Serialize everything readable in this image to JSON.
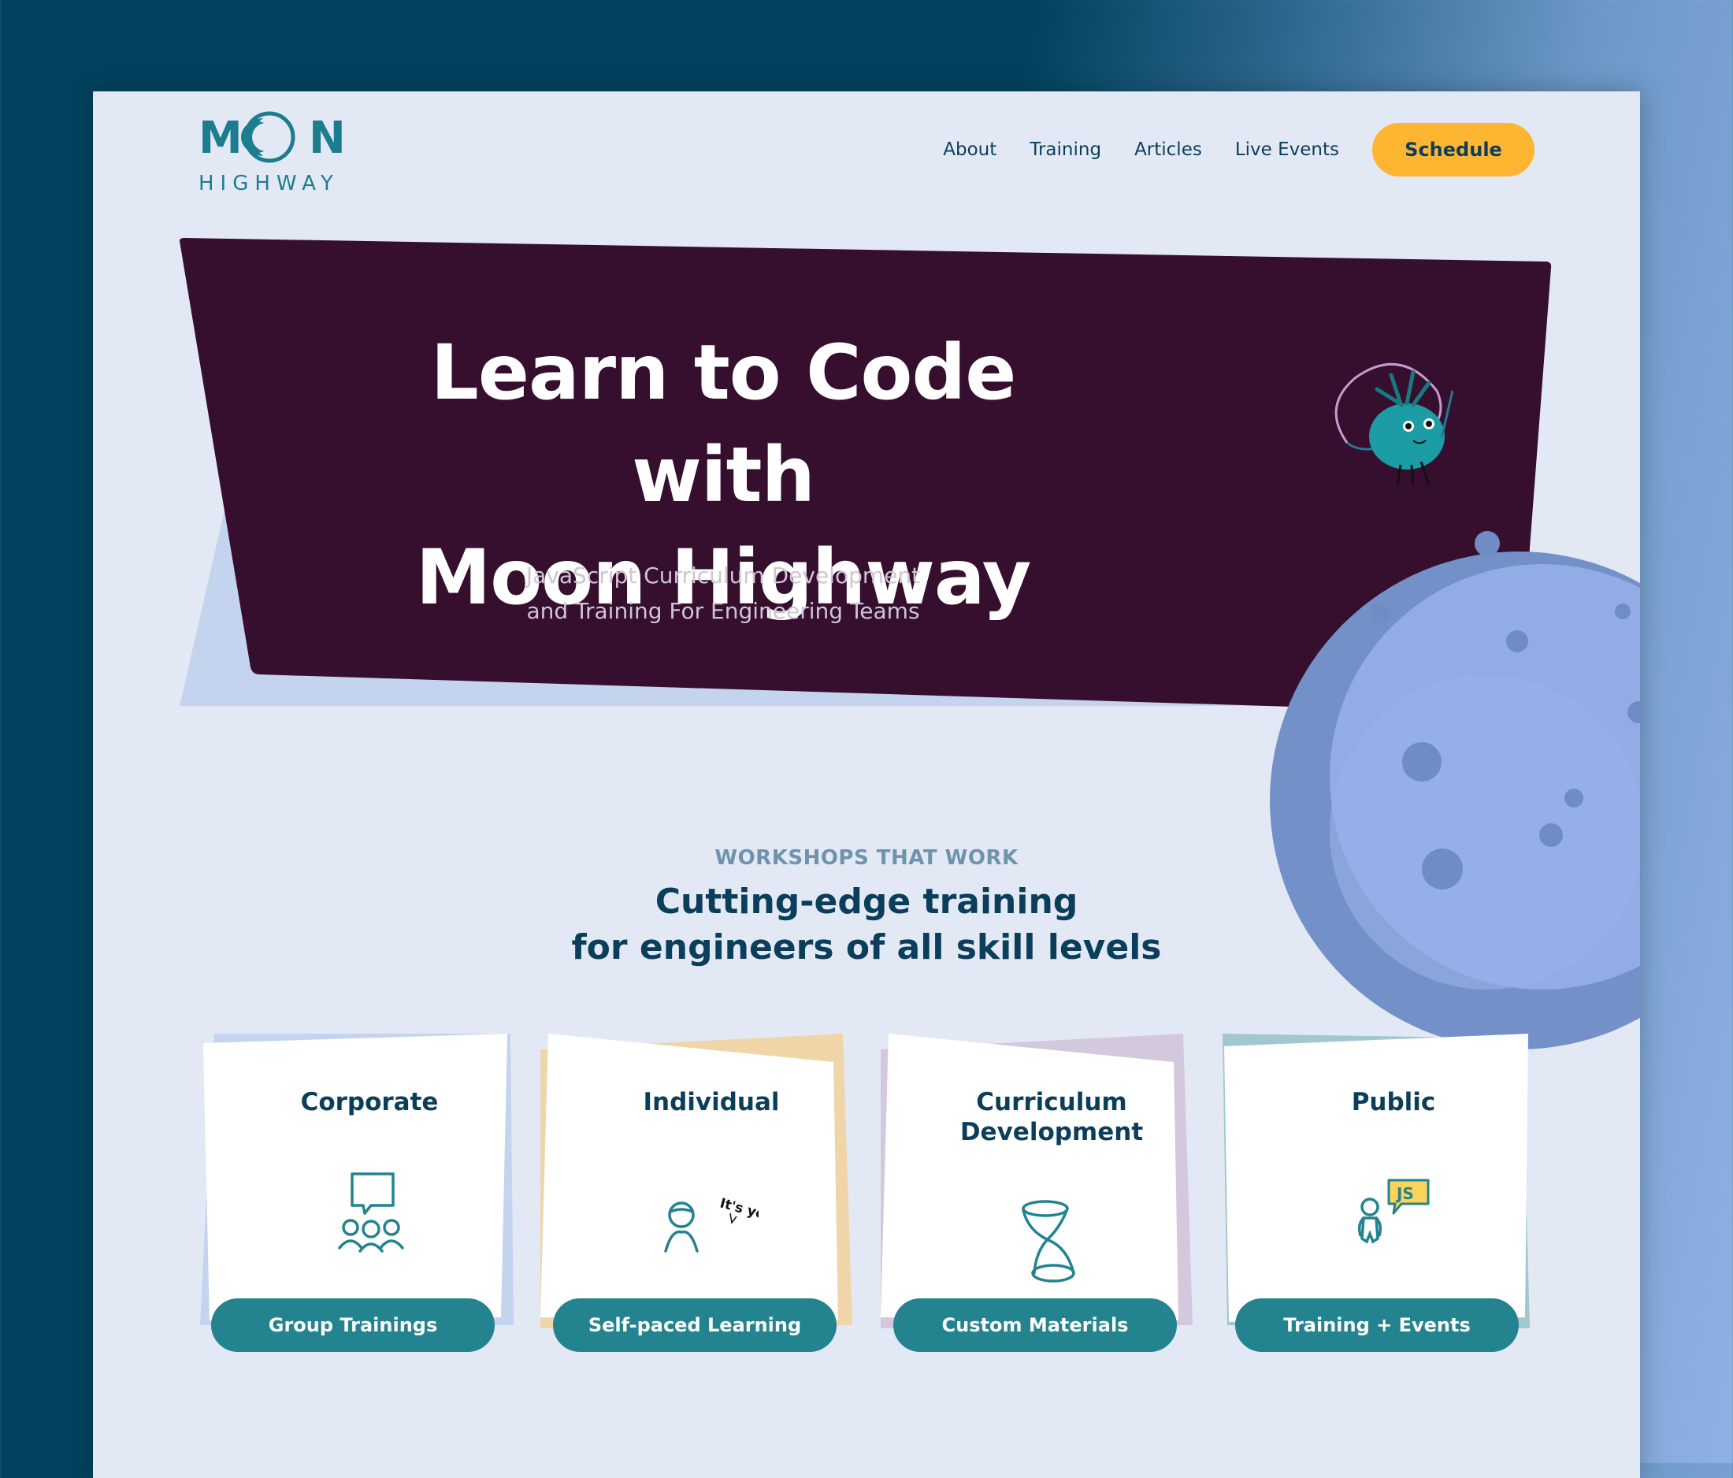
{
  "logo": {
    "top": "MOON",
    "word": "HIGHWAY"
  },
  "nav": {
    "items": [
      "About",
      "Training",
      "Articles",
      "Live Events"
    ],
    "cta": "Schedule"
  },
  "hero": {
    "title_line1": "Learn to Code with",
    "title_line2": "Moon Highway",
    "subtitle_line1": "JavaScript Curriculum Development",
    "subtitle_line2": "and Training For Engineering Teams"
  },
  "workshops": {
    "eyebrow": "WORKSHOPS THAT WORK",
    "title_line1": "Cutting-edge training",
    "title_line2": "for engineers of all skill levels"
  },
  "cards": [
    {
      "title": "Corporate",
      "button": "Group Trainings",
      "icon": "group-chat-icon",
      "accent": "#c4d4ee"
    },
    {
      "title": "Individual",
      "button": "Self-paced Learning",
      "icon": "person-its-you-icon",
      "icon_text": "It's you",
      "accent": "#efd5a8"
    },
    {
      "title_line1": "Curriculum",
      "title_line2": "Development",
      "button": "Custom Materials",
      "icon": "hourglass-icon",
      "accent": "#d4c8dc"
    },
    {
      "title": "Public",
      "button": "Training + Events",
      "icon": "person-js-icon",
      "icon_text": "JS",
      "accent": "#a1c7cf"
    }
  ],
  "colors": {
    "hero_bg": "#360e2e",
    "accent_teal": "#23838f",
    "cta_yellow": "#fdb532",
    "heading_navy": "#0b3e5a",
    "moon": "#8fa9e4"
  }
}
